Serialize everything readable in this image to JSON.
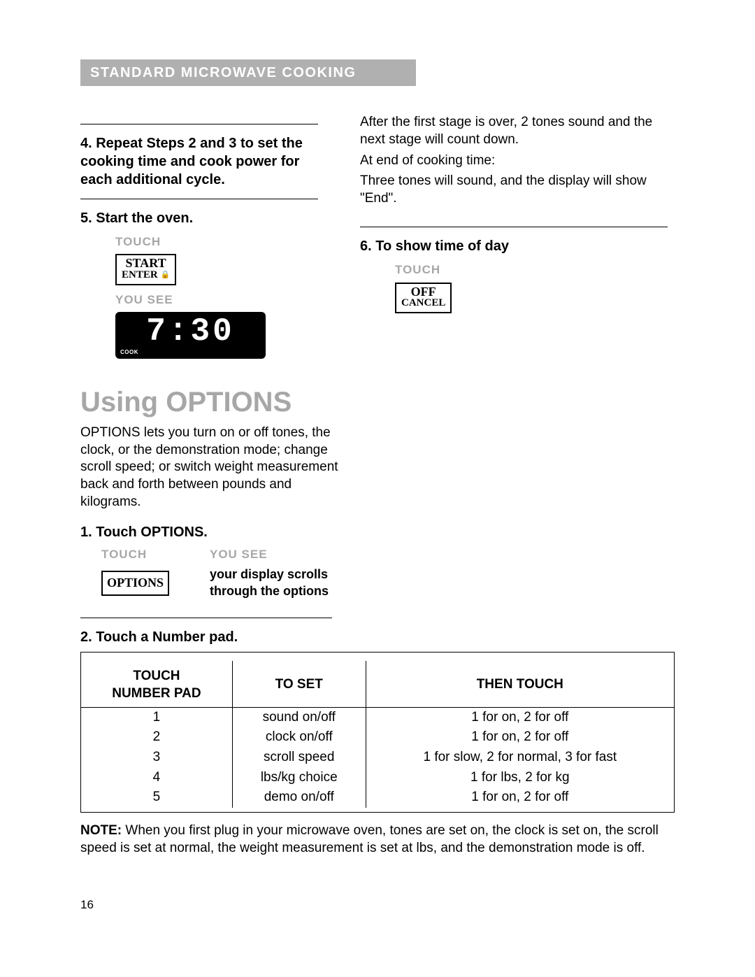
{
  "header": "STANDARD MICROWAVE COOKING",
  "left": {
    "step4": "4. Repeat Steps 2 and 3 to set the cooking time and cook power for each additional cycle.",
    "step5_title": "5. Start the oven.",
    "touch": "TOUCH",
    "start_btn_l1": "START",
    "start_btn_l2": "ENTER",
    "lock_glyph": "🔒",
    "yousee": "YOU SEE",
    "display_time": "7:30",
    "display_cook": "COOK"
  },
  "right": {
    "p1": "After the first stage is over, 2 tones sound and the next stage will count down.",
    "p2": "At end of cooking time:",
    "p3": "Three tones will sound, and the display will show \"End\".",
    "step6_title": "6. To show time of day",
    "touch": "TOUCH",
    "off_l1": "OFF",
    "off_l2": "CANCEL"
  },
  "options": {
    "title": "Using OPTIONS",
    "intro": "OPTIONS lets you turn on or off tones, the clock, or the demonstration mode; change scroll speed; or switch weight measurement back and forth between pounds and kilograms.",
    "step1_title": "1. Touch OPTIONS.",
    "touch": "TOUCH",
    "yousee": "YOU SEE",
    "yousee_text": "your display scrolls through the options",
    "options_btn": "OPTIONS",
    "step2_title": "2. Touch a Number pad.",
    "table": {
      "h1a": "TOUCH",
      "h1b": "NUMBER PAD",
      "h2": "TO SET",
      "h3": "THEN TOUCH",
      "rows": [
        {
          "n": "1",
          "set": "sound on/off",
          "then": "1 for on, 2 for off"
        },
        {
          "n": "2",
          "set": "clock on/off",
          "then": "1 for on, 2 for off"
        },
        {
          "n": "3",
          "set": "scroll speed",
          "then": "1 for slow, 2 for normal, 3 for fast"
        },
        {
          "n": "4",
          "set": "lbs/kg choice",
          "then": "1 for lbs, 2 for kg"
        },
        {
          "n": "5",
          "set": "demo on/off",
          "then": "1 for on, 2 for off"
        }
      ]
    },
    "note_label": "NOTE:",
    "note": " When you first plug in your microwave oven, tones are set on, the clock is set on, the scroll speed is set at normal, the weight measurement is set at lbs, and the demonstration mode is off."
  },
  "page": "16"
}
